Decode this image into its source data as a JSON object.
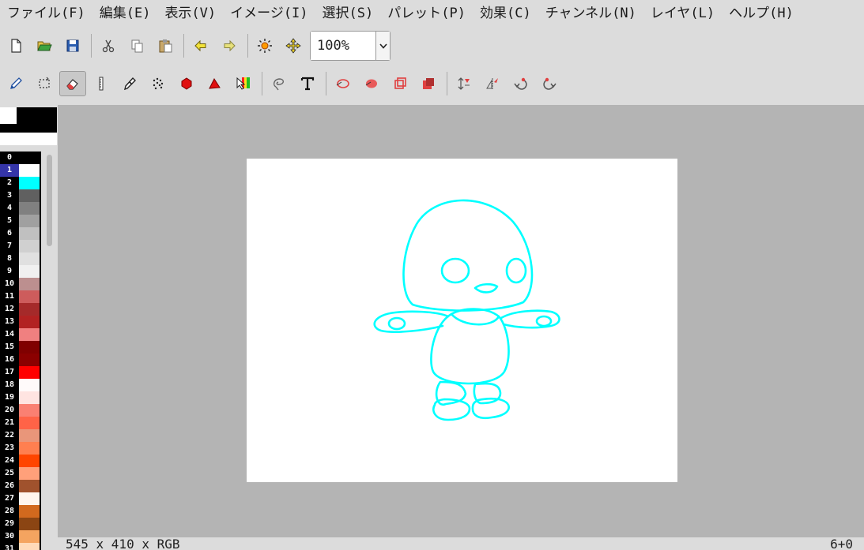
{
  "menu": [
    "ファイル(F)",
    "編集(E)",
    "表示(V)",
    "イメージ(I)",
    "選択(S)",
    "パレット(P)",
    "効果(C)",
    "チャンネル(N)",
    "レイヤ(L)",
    "ヘルプ(H)"
  ],
  "toolbar": {
    "zoom_value": "100%"
  },
  "icons": {
    "file": [
      "new-file-icon",
      "open-folder-icon",
      "save-icon"
    ],
    "edit": [
      "cut-icon",
      "copy-icon",
      "paste-icon"
    ],
    "history": [
      "undo-arrow-icon",
      "redo-arrow-icon"
    ],
    "view": [
      "brightness-icon",
      "move-cross-icon"
    ],
    "tools": [
      "pencil-icon",
      "select-rect-icon",
      "eraser-icon",
      "ruler-icon",
      "pen-icon",
      "spray-icon",
      "fill-icon",
      "color-picker-icon",
      "gradient-select-icon",
      "lasso-icon",
      "text-icon",
      "ellipse-icon",
      "filled-ellipse-icon",
      "rectangle-icon",
      "filled-rectangle-icon",
      "flip-vertical-icon",
      "flip-horizontal-icon",
      "rotate-left-icon",
      "rotate-right-icon"
    ]
  },
  "palette": [
    {
      "index": "0",
      "color": "#000000"
    },
    {
      "index": "1",
      "color": "#ffffff"
    },
    {
      "index": "2",
      "color": "#00ffff"
    },
    {
      "index": "3",
      "color": "#606060"
    },
    {
      "index": "4",
      "color": "#808080"
    },
    {
      "index": "5",
      "color": "#a0a0a0"
    },
    {
      "index": "6",
      "color": "#c0c0c0"
    },
    {
      "index": "7",
      "color": "#d0d0d0"
    },
    {
      "index": "8",
      "color": "#e0e0e0"
    },
    {
      "index": "9",
      "color": "#f0f0f0"
    },
    {
      "index": "10",
      "color": "#bc8f8f"
    },
    {
      "index": "11",
      "color": "#cd5c5c"
    },
    {
      "index": "12",
      "color": "#a52a2a"
    },
    {
      "index": "13",
      "color": "#b22222"
    },
    {
      "index": "14",
      "color": "#f08080"
    },
    {
      "index": "15",
      "color": "#800000"
    },
    {
      "index": "16",
      "color": "#8b0000"
    },
    {
      "index": "17",
      "color": "#ff0000"
    },
    {
      "index": "18",
      "color": "#fffafa"
    },
    {
      "index": "19",
      "color": "#ffe4e1"
    },
    {
      "index": "20",
      "color": "#fa8072"
    },
    {
      "index": "21",
      "color": "#ff6347"
    },
    {
      "index": "22",
      "color": "#e9967a"
    },
    {
      "index": "23",
      "color": "#ff7f50"
    },
    {
      "index": "24",
      "color": "#ff4500"
    },
    {
      "index": "25",
      "color": "#ffa07a"
    },
    {
      "index": "26",
      "color": "#a0522d"
    },
    {
      "index": "27",
      "color": "#fff5ee"
    },
    {
      "index": "28",
      "color": "#d2691e"
    },
    {
      "index": "29",
      "color": "#8b4513"
    },
    {
      "index": "30",
      "color": "#f4a460"
    },
    {
      "index": "31",
      "color": "#ffdab9"
    }
  ],
  "selected_palette_index": "1",
  "status": {
    "image_info": "545 x 410 x RGB",
    "coords": "6+0"
  },
  "colors": {
    "drawing_stroke": "#00ffff",
    "workspace_bg": "#b4b4b4",
    "palette_selected_bg": "#3535a8"
  }
}
